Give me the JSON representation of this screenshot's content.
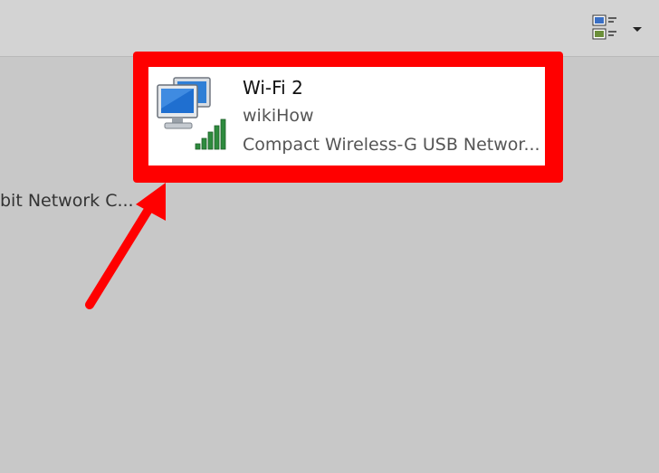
{
  "toolbar": {
    "view_button_icon": "change-view-icon",
    "dropdown_icon": "chevron-down-icon"
  },
  "adapters": {
    "left_partial_label": "bit Network C...",
    "selected": {
      "name": "Wi-Fi 2",
      "network": "wikiHow",
      "device": "Compact Wireless-G USB Networ...",
      "icon": "wireless-network-adapter-icon",
      "signal_bars_filled": 5
    }
  },
  "annotation": {
    "highlight_color": "#ff0000",
    "arrow_color": "#ff0000"
  }
}
